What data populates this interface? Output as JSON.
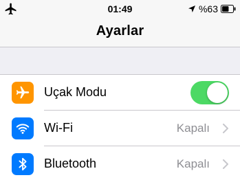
{
  "status_bar": {
    "time": "01:49",
    "battery_text": "%63",
    "left_icon": "airplane-icon",
    "right_icons": [
      "location-arrow-icon",
      "battery-icon"
    ]
  },
  "nav": {
    "title": "Ayarlar"
  },
  "settings": {
    "rows": [
      {
        "label": "Uçak Modu",
        "icon": "airplane-icon",
        "icon_color": "#ff9500",
        "toggle_on": true,
        "toggle_color": "#4cd964"
      },
      {
        "label": "Wi-Fi",
        "icon": "wifi-icon",
        "icon_color": "#007aff",
        "value": "Kapalı"
      },
      {
        "label": "Bluetooth",
        "icon": "bluetooth-icon",
        "icon_color": "#007aff",
        "value": "Kapalı"
      }
    ]
  }
}
